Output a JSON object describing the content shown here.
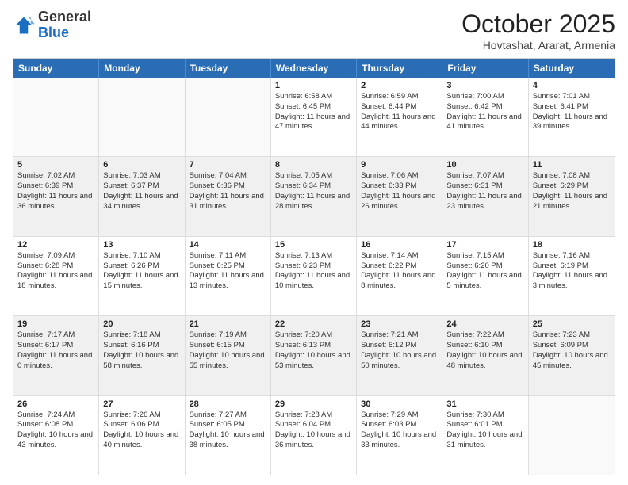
{
  "header": {
    "logo_general": "General",
    "logo_blue": "Blue",
    "month_title": "October 2025",
    "subtitle": "Hovtashat, Ararat, Armenia"
  },
  "calendar": {
    "days_of_week": [
      "Sunday",
      "Monday",
      "Tuesday",
      "Wednesday",
      "Thursday",
      "Friday",
      "Saturday"
    ],
    "weeks": [
      [
        {
          "day": "",
          "info": ""
        },
        {
          "day": "",
          "info": ""
        },
        {
          "day": "",
          "info": ""
        },
        {
          "day": "1",
          "info": "Sunrise: 6:58 AM\nSunset: 6:45 PM\nDaylight: 11 hours and 47 minutes."
        },
        {
          "day": "2",
          "info": "Sunrise: 6:59 AM\nSunset: 6:44 PM\nDaylight: 11 hours and 44 minutes."
        },
        {
          "day": "3",
          "info": "Sunrise: 7:00 AM\nSunset: 6:42 PM\nDaylight: 11 hours and 41 minutes."
        },
        {
          "day": "4",
          "info": "Sunrise: 7:01 AM\nSunset: 6:41 PM\nDaylight: 11 hours and 39 minutes."
        }
      ],
      [
        {
          "day": "5",
          "info": "Sunrise: 7:02 AM\nSunset: 6:39 PM\nDaylight: 11 hours and 36 minutes."
        },
        {
          "day": "6",
          "info": "Sunrise: 7:03 AM\nSunset: 6:37 PM\nDaylight: 11 hours and 34 minutes."
        },
        {
          "day": "7",
          "info": "Sunrise: 7:04 AM\nSunset: 6:36 PM\nDaylight: 11 hours and 31 minutes."
        },
        {
          "day": "8",
          "info": "Sunrise: 7:05 AM\nSunset: 6:34 PM\nDaylight: 11 hours and 28 minutes."
        },
        {
          "day": "9",
          "info": "Sunrise: 7:06 AM\nSunset: 6:33 PM\nDaylight: 11 hours and 26 minutes."
        },
        {
          "day": "10",
          "info": "Sunrise: 7:07 AM\nSunset: 6:31 PM\nDaylight: 11 hours and 23 minutes."
        },
        {
          "day": "11",
          "info": "Sunrise: 7:08 AM\nSunset: 6:29 PM\nDaylight: 11 hours and 21 minutes."
        }
      ],
      [
        {
          "day": "12",
          "info": "Sunrise: 7:09 AM\nSunset: 6:28 PM\nDaylight: 11 hours and 18 minutes."
        },
        {
          "day": "13",
          "info": "Sunrise: 7:10 AM\nSunset: 6:26 PM\nDaylight: 11 hours and 15 minutes."
        },
        {
          "day": "14",
          "info": "Sunrise: 7:11 AM\nSunset: 6:25 PM\nDaylight: 11 hours and 13 minutes."
        },
        {
          "day": "15",
          "info": "Sunrise: 7:13 AM\nSunset: 6:23 PM\nDaylight: 11 hours and 10 minutes."
        },
        {
          "day": "16",
          "info": "Sunrise: 7:14 AM\nSunset: 6:22 PM\nDaylight: 11 hours and 8 minutes."
        },
        {
          "day": "17",
          "info": "Sunrise: 7:15 AM\nSunset: 6:20 PM\nDaylight: 11 hours and 5 minutes."
        },
        {
          "day": "18",
          "info": "Sunrise: 7:16 AM\nSunset: 6:19 PM\nDaylight: 11 hours and 3 minutes."
        }
      ],
      [
        {
          "day": "19",
          "info": "Sunrise: 7:17 AM\nSunset: 6:17 PM\nDaylight: 11 hours and 0 minutes."
        },
        {
          "day": "20",
          "info": "Sunrise: 7:18 AM\nSunset: 6:16 PM\nDaylight: 10 hours and 58 minutes."
        },
        {
          "day": "21",
          "info": "Sunrise: 7:19 AM\nSunset: 6:15 PM\nDaylight: 10 hours and 55 minutes."
        },
        {
          "day": "22",
          "info": "Sunrise: 7:20 AM\nSunset: 6:13 PM\nDaylight: 10 hours and 53 minutes."
        },
        {
          "day": "23",
          "info": "Sunrise: 7:21 AM\nSunset: 6:12 PM\nDaylight: 10 hours and 50 minutes."
        },
        {
          "day": "24",
          "info": "Sunrise: 7:22 AM\nSunset: 6:10 PM\nDaylight: 10 hours and 48 minutes."
        },
        {
          "day": "25",
          "info": "Sunrise: 7:23 AM\nSunset: 6:09 PM\nDaylight: 10 hours and 45 minutes."
        }
      ],
      [
        {
          "day": "26",
          "info": "Sunrise: 7:24 AM\nSunset: 6:08 PM\nDaylight: 10 hours and 43 minutes."
        },
        {
          "day": "27",
          "info": "Sunrise: 7:26 AM\nSunset: 6:06 PM\nDaylight: 10 hours and 40 minutes."
        },
        {
          "day": "28",
          "info": "Sunrise: 7:27 AM\nSunset: 6:05 PM\nDaylight: 10 hours and 38 minutes."
        },
        {
          "day": "29",
          "info": "Sunrise: 7:28 AM\nSunset: 6:04 PM\nDaylight: 10 hours and 36 minutes."
        },
        {
          "day": "30",
          "info": "Sunrise: 7:29 AM\nSunset: 6:03 PM\nDaylight: 10 hours and 33 minutes."
        },
        {
          "day": "31",
          "info": "Sunrise: 7:30 AM\nSunset: 6:01 PM\nDaylight: 10 hours and 31 minutes."
        },
        {
          "day": "",
          "info": ""
        }
      ]
    ]
  }
}
